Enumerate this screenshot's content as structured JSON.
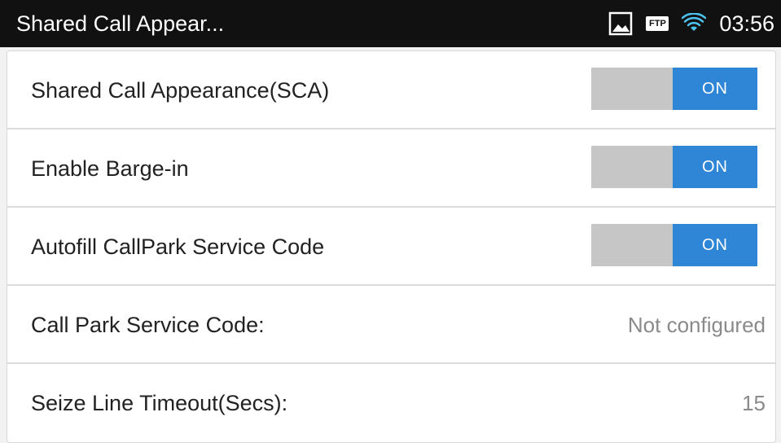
{
  "status_bar": {
    "title": "Shared Call Appear...",
    "icons": [
      "image-icon",
      "ftp-icon",
      "wifi-icon"
    ],
    "ftp_label": "FTP",
    "time": "03:56"
  },
  "settings": [
    {
      "label": "Shared Call Appearance(SCA)",
      "type": "toggle",
      "state": "ON"
    },
    {
      "label": "Enable Barge-in",
      "type": "toggle",
      "state": "ON"
    },
    {
      "label": "Autofill CallPark Service Code",
      "type": "toggle",
      "state": "ON"
    },
    {
      "label": "Call Park Service Code:",
      "type": "value",
      "value": "Not configured"
    },
    {
      "label": "Seize Line Timeout(Secs):",
      "type": "value",
      "value": "15"
    }
  ],
  "colors": {
    "status_bar_bg": "#111111",
    "toggle_on": "#2f86d6",
    "toggle_track": "#c6c6c6",
    "secondary_text": "#8a8a8a"
  }
}
